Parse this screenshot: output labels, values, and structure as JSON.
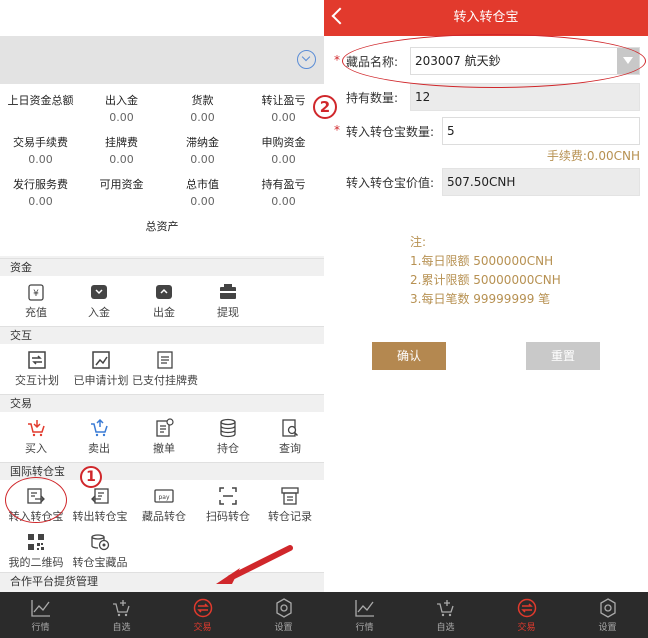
{
  "left": {
    "stats": [
      {
        "label": "上日资金总额",
        "value": ""
      },
      {
        "label": "出入金",
        "value": "0.00"
      },
      {
        "label": "货款",
        "value": "0.00"
      },
      {
        "label": "转让盈亏",
        "value": "0.00"
      },
      {
        "label": "交易手续费",
        "value": "0.00"
      },
      {
        "label": "挂牌费",
        "value": "0.00"
      },
      {
        "label": "滞纳金",
        "value": "0.00"
      },
      {
        "label": "申购资金",
        "value": "0.00"
      },
      {
        "label": "发行服务费",
        "value": "0.00"
      },
      {
        "label": "可用资金",
        "value": ""
      },
      {
        "label": "总市值",
        "value": "0.00"
      },
      {
        "label": "持有盈亏",
        "value": "0.00"
      }
    ],
    "total_label": "总资产",
    "sections": [
      {
        "title": "资金",
        "items": [
          {
            "label": "充值",
            "icon": "recharge-icon"
          },
          {
            "label": "入金",
            "icon": "deposit-icon"
          },
          {
            "label": "出金",
            "icon": "withdraw-icon"
          },
          {
            "label": "提现",
            "icon": "cash-out-icon"
          }
        ]
      },
      {
        "title": "交互",
        "items": [
          {
            "label": "交互计划",
            "icon": "exchange-plan-icon"
          },
          {
            "label": "已申请计划",
            "icon": "applied-plan-icon"
          },
          {
            "label": "已支付挂牌费",
            "icon": "paid-fee-icon"
          }
        ]
      },
      {
        "title": "交易",
        "items": [
          {
            "label": "买入",
            "icon": "buy-icon"
          },
          {
            "label": "卖出",
            "icon": "sell-icon"
          },
          {
            "label": "撤单",
            "icon": "cancel-order-icon"
          },
          {
            "label": "持仓",
            "icon": "position-icon"
          },
          {
            "label": "查询",
            "icon": "query-icon"
          }
        ]
      },
      {
        "title": "国际转仓宝",
        "items": [
          {
            "label": "转入转仓宝",
            "icon": "transfer-in-icon"
          },
          {
            "label": "转出转仓宝",
            "icon": "transfer-out-icon"
          },
          {
            "label": "藏品转仓",
            "icon": "pay-icon"
          },
          {
            "label": "扫码转仓",
            "icon": "scan-icon"
          },
          {
            "label": "转仓记录",
            "icon": "record-icon"
          }
        ]
      },
      {
        "title": "",
        "items": [
          {
            "label": "我的二维码",
            "icon": "qrcode-icon"
          },
          {
            "label": "转仓宝藏品",
            "icon": "coins-icon"
          }
        ]
      }
    ],
    "last_section_title": "合作平台提货管理",
    "callout_number": "1"
  },
  "tabs": [
    {
      "label": "行情",
      "icon": "chart-icon"
    },
    {
      "label": "自选",
      "icon": "cart-icon"
    },
    {
      "label": "交易",
      "icon": "trade-icon"
    },
    {
      "label": "设置",
      "icon": "gear-icon"
    }
  ],
  "right": {
    "title": "转入转仓宝",
    "fields": {
      "name_label": "藏品名称:",
      "name_value": "203007 航天鈔",
      "hold_label": "持有数量:",
      "hold_value": "12",
      "qty_label": "转入转仓宝数量:",
      "qty_value": "5",
      "value_label": "转入转仓宝价值:",
      "value_value": "507.50CNH"
    },
    "fee": "手续费:0.00CNH",
    "notes": [
      "注:",
      "1.每日限额  5000000CNH",
      "2.累计限额  50000000CNH",
      "3.每日笔数  99999999 笔"
    ],
    "confirm_label": "确认",
    "reset_label": "重置",
    "callout_number": "2"
  },
  "colors": {
    "brand_red": "#e23a2d",
    "gold": "#b48850",
    "callout": "#d0272b"
  }
}
